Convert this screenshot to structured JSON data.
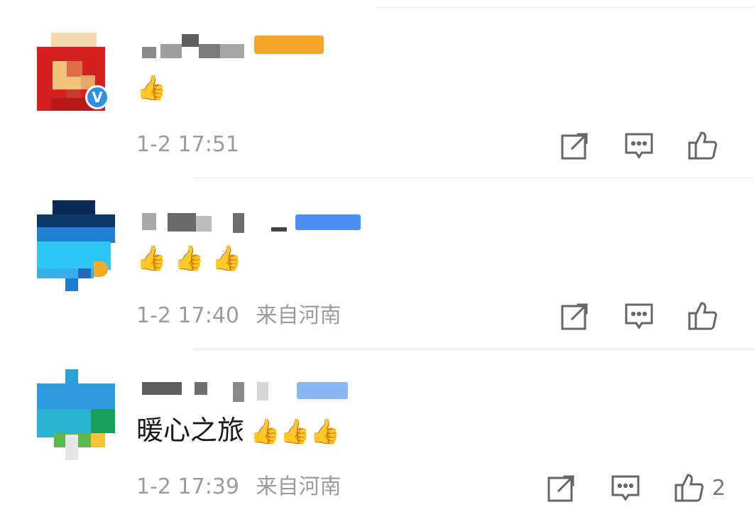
{
  "comments": [
    {
      "text": "",
      "emojis": "👍",
      "time": "1-2 17:51",
      "location": "",
      "verified_mark": "V",
      "likes": ""
    },
    {
      "text": "",
      "emojis": "👍 👍 👍",
      "time": "1-2 17:40",
      "location": "来自河南",
      "likes": ""
    },
    {
      "text": "暖心之旅",
      "emojis": "👍👍👍",
      "time": "1-2 17:39",
      "location": "来自河南",
      "likes": "2"
    }
  ],
  "icons": {
    "share": "share-icon",
    "comment": "comment-icon",
    "like": "thumbs-up-icon"
  },
  "colors": {
    "meta_text": "#9b9b9b",
    "divider": "#e6e6e6",
    "verified_badge": "#2f8fe0",
    "icon_stroke": "#666666"
  }
}
